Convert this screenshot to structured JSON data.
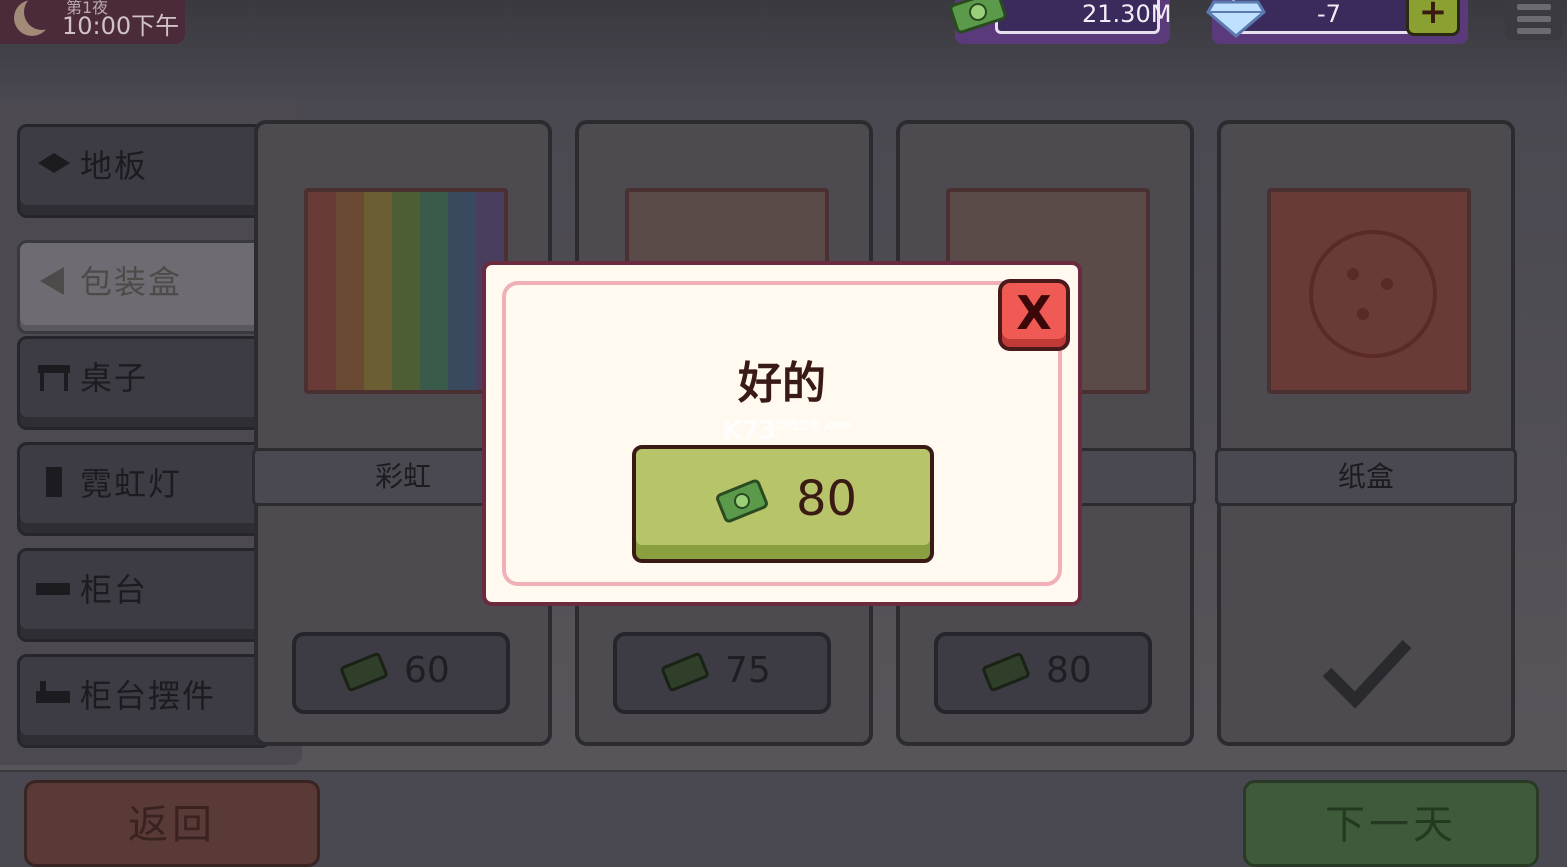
{
  "hud": {
    "day_label": "第1夜",
    "time": "10:00下午",
    "cash": "21.30M",
    "gems": "-7",
    "add_label": "+"
  },
  "sidebar": {
    "items": [
      {
        "label": "地板"
      },
      {
        "label": "包装盒"
      },
      {
        "label": "桌子"
      },
      {
        "label": "霓虹灯"
      },
      {
        "label": "柜台"
      },
      {
        "label": "柜台摆件"
      }
    ]
  },
  "cards": [
    {
      "name": "彩虹",
      "price": "60"
    },
    {
      "name": "",
      "price": "75"
    },
    {
      "name": "",
      "price": "80"
    },
    {
      "name": "纸盒"
    }
  ],
  "dialog": {
    "title": "好的",
    "close_label": "X",
    "buy_price": "80"
  },
  "watermark": {
    "text": "K73",
    "sub": "游戏之家 .com"
  },
  "footer": {
    "back_label": "返回",
    "next_label": "下一天"
  },
  "colors": {
    "dialog_bg": "#fff9f0",
    "buy_button": "#b8c46a",
    "close_button": "#f05a55",
    "hud_purple": "#5a3a7a"
  }
}
